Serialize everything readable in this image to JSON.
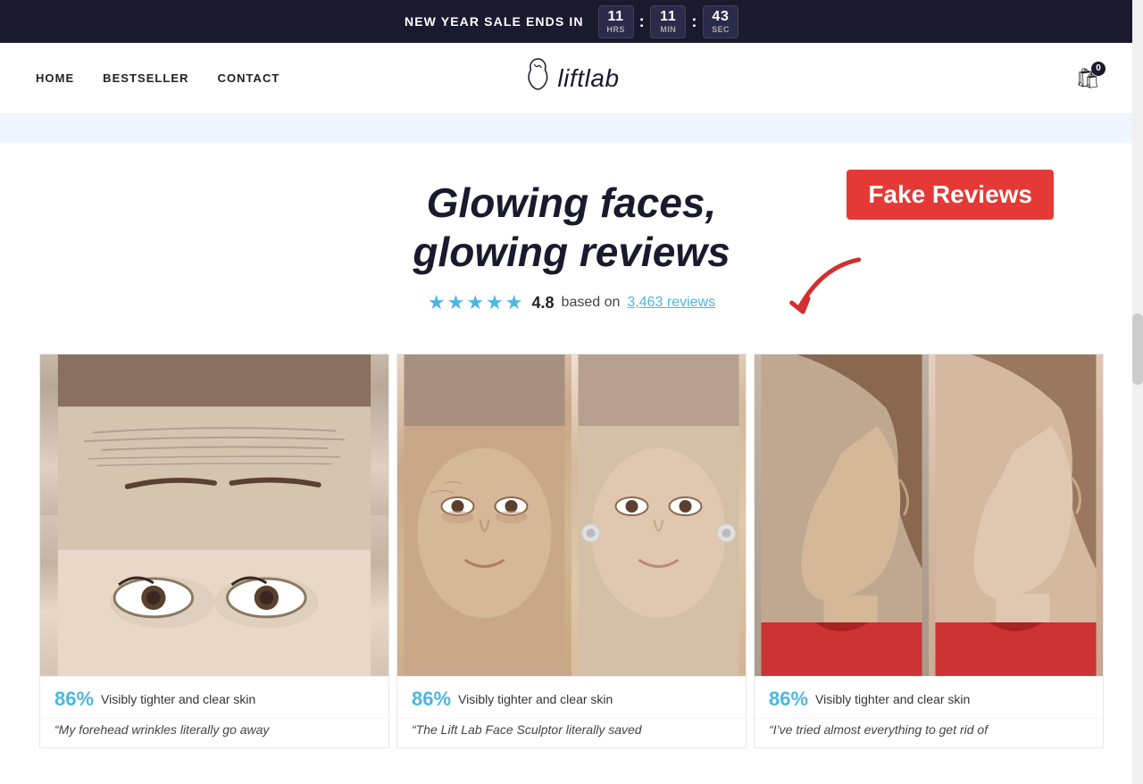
{
  "banner": {
    "sale_text": "NEW YEAR SALE ENDS IN",
    "hours_num": "11",
    "hours_label": "HRS",
    "min_num": "11",
    "min_label": "MIN",
    "sep": ":",
    "sec_num": "43",
    "sec_label": "SEC"
  },
  "nav": {
    "home": "HOME",
    "bestseller": "BESTSELLER",
    "contact": "CONTACT",
    "logo_text": "liftlab",
    "cart_count": "0"
  },
  "hero": {
    "title_line1": "Glowing faces,",
    "title_line2": "glowing reviews",
    "rating_num": "4.8",
    "rating_base": "based on",
    "rating_link": "3,463 reviews",
    "fake_reviews_label": "Fake Reviews"
  },
  "products": [
    {
      "stat_percent": "86%",
      "stat_text": "Visibly tighter and clear skin",
      "quote": "“My forehead wrinkles literally go away"
    },
    {
      "stat_percent": "86%",
      "stat_text": "Visibly tighter and clear skin",
      "quote": "“The Lift Lab Face Sculptor literally saved"
    },
    {
      "stat_percent": "86%",
      "stat_text": "Visibly tighter and clear skin",
      "quote": "“I’ve tried almost everything to get rid of"
    }
  ]
}
